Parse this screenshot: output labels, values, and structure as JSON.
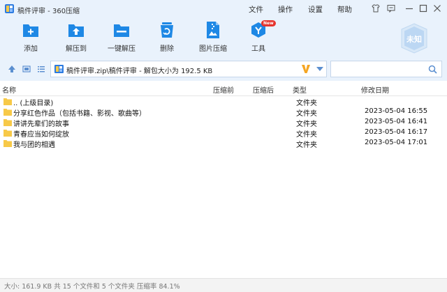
{
  "window": {
    "title": "稿件评审 - 360压缩",
    "menus": [
      "文件",
      "操作",
      "设置",
      "帮助"
    ]
  },
  "toolbar": {
    "buttons": [
      {
        "label": "添加",
        "icon": "add-folder-icon"
      },
      {
        "label": "解压到",
        "icon": "extract-to-icon"
      },
      {
        "label": "一键解压",
        "icon": "one-click-extract-icon"
      },
      {
        "label": "删除",
        "icon": "delete-icon"
      },
      {
        "label": "图片压缩",
        "icon": "image-compress-icon"
      },
      {
        "label": "工具",
        "icon": "tools-icon",
        "badge": "New"
      }
    ],
    "shield_label": "未知"
  },
  "address": {
    "path": "稿件评审.zip\\稿件评审 - 解包大小为 192.5 KB",
    "search_placeholder": ""
  },
  "columns": {
    "name": "名称",
    "compressed": "压缩前",
    "original": "压缩后",
    "type": "类型",
    "modified": "修改日期"
  },
  "files": [
    {
      "name": ".. (上级目录)",
      "type": "文件夹",
      "modified": ""
    },
    {
      "name": "分享红色作品（包括书籍、影视、歌曲等）",
      "type": "文件夹",
      "modified": "2023-05-04 16:55"
    },
    {
      "name": "讲讲先辈们的故事",
      "type": "文件夹",
      "modified": "2023-05-04 16:41"
    },
    {
      "name": "青春应当如何绽放",
      "type": "文件夹",
      "modified": "2023-05-04 16:17"
    },
    {
      "name": "我与团的相遇",
      "type": "文件夹",
      "modified": "2023-05-04 17:01"
    }
  ],
  "status": {
    "text": "大小: 161.9 KB 共 15 个文件和 5 个文件夹 压缩率 84.1%"
  },
  "colors": {
    "chrome_bg": "#e9f2fc",
    "icon_blue": "#1e88e5",
    "folder_yellow": "#f7c948",
    "accent_orange": "#f5a623"
  }
}
